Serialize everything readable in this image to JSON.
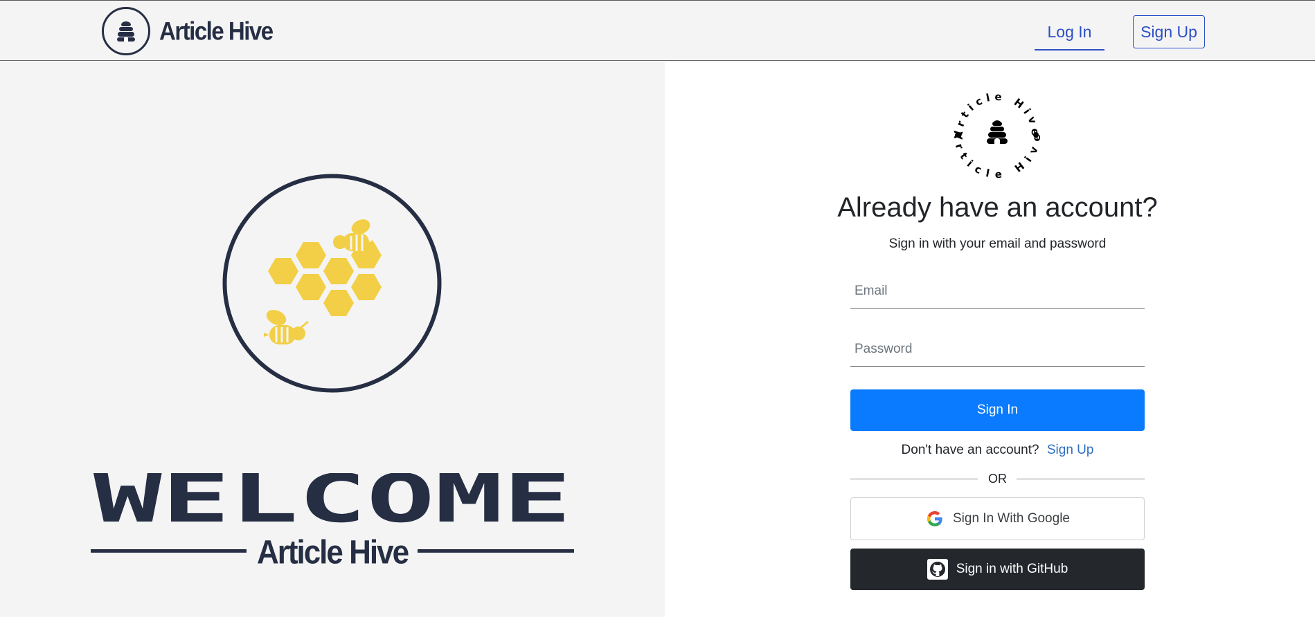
{
  "header": {
    "brand_name": "Article Hive",
    "login_label": "Log In",
    "signup_label": "Sign Up"
  },
  "hero": {
    "welcome_text": "WELCOME",
    "brand_name": "Article Hive"
  },
  "login_form": {
    "logo_text": "Article Hive",
    "heading": "Already have an account?",
    "subheading": "Sign in with your email and password",
    "email_placeholder": "Email",
    "password_placeholder": "Password",
    "signin_label": "Sign In",
    "no_account_text": "Don't have an account?",
    "signup_link": "Sign Up",
    "divider_text": "OR",
    "google_label": "Sign In With Google",
    "github_label": "Sign in with GitHub"
  },
  "colors": {
    "navy": "#262e44",
    "honey": "#f2cf46",
    "primary_blue": "#0a7bff",
    "link_blue": "#2b4fc7",
    "github_dark": "#24282d",
    "panel_gray": "#f4f4f4"
  },
  "icons": [
    "beehive-icon",
    "bee-icon",
    "honeycomb-icon",
    "google-icon",
    "github-icon"
  ]
}
